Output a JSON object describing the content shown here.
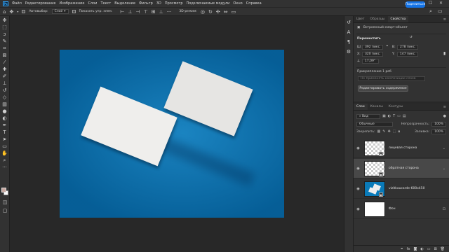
{
  "menubar": {
    "logo": "Ps",
    "items": [
      "Файл",
      "Редактирование",
      "Изображение",
      "Слои",
      "Текст",
      "Выделение",
      "Фильтр",
      "3D",
      "Просмотр",
      "Подключаемые модули",
      "Окно",
      "Справка"
    ],
    "window_controls": [
      "—",
      "☐",
      "✕"
    ]
  },
  "options": {
    "autoselect_label": "Автовыбор:",
    "autoselect_value": "Слой",
    "transform_label": "Показать упр. элем.",
    "mode3d_label": "3D-режим:",
    "share_label": "Поделиться"
  },
  "properties_panel": {
    "tabs": [
      "Цвет",
      "Образцы",
      "Свойства"
    ],
    "active_tab": 2,
    "object_type": "Встроенный смарт-объект",
    "section_transform": "Переместить",
    "width_label": "Ш:",
    "width_value": "392 пикс.",
    "height_label": "В:",
    "height_value": "278 пикс.",
    "x_label": "X:",
    "x_value": "320 пикс.",
    "y_label": "Y:",
    "y_value": "147 пикс.",
    "angle_value": "17,09°",
    "section_layercomp": "Прикрепление 1 реб",
    "layercomp_hint": "Не применять композиции слоев",
    "edit_button": "Редактировать содержимое"
  },
  "layers_panel": {
    "tabs": [
      "Слои",
      "Каналы",
      "Контуры"
    ],
    "active_tab": 0,
    "filter_kind": "Вид",
    "blend_mode": "Обычные",
    "opacity_label": "Непрозрачность:",
    "opacity_value": "100%",
    "lock_label": "Закрепить:",
    "fill_label": "Заливка:",
    "fill_value": "100%",
    "layers": [
      {
        "name": "лицевая сторона",
        "thumb": "checker",
        "selected": false
      },
      {
        "name": "обратная сторона",
        "thumb": "checker",
        "selected": true
      },
      {
        "name": "vizitkaucarde-600x450",
        "thumb": "photo",
        "selected": false
      },
      {
        "name": "Фон",
        "thumb": "white",
        "selected": false
      }
    ]
  },
  "colors": {
    "accent": "#1473e6",
    "document_bg": "#0a7ab8",
    "foreground_swatch": "#c8a8a0",
    "background_swatch": "#ffffff"
  }
}
